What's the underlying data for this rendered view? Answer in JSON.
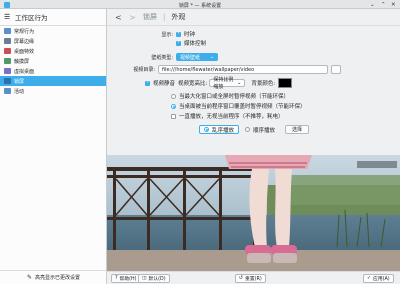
{
  "window": {
    "title": "锁屏 * — 系统设置",
    "min_glyph": "⌄",
    "max_glyph": "⌃",
    "close_glyph": "✕"
  },
  "sidebar": {
    "header": "工作区行为",
    "items": [
      {
        "label": "常规行为",
        "color": "#5a8fc9"
      },
      {
        "label": "屏幕边缘",
        "color": "#6a7f96"
      },
      {
        "label": "桌面特效",
        "color": "#c94f5a"
      },
      {
        "label": "触摸屏",
        "color": "#4f9a68"
      },
      {
        "label": "虚拟桌面",
        "color": "#7a6fc9"
      },
      {
        "label": "锁屏",
        "color": "#2e6fb0"
      },
      {
        "label": "活动",
        "color": "#5a8fc9"
      }
    ],
    "selected_index": 5,
    "footer": "高亮显示已更改设置"
  },
  "nav": {
    "back": "<",
    "forward": ">",
    "crumb": "锁屏",
    "separator": "|",
    "current": "外观"
  },
  "form": {
    "display_label": "显示:",
    "clock_label": "时钟",
    "media_label": "媒体控制",
    "wallpaper_type_label": "壁纸类型:",
    "wallpaper_type_value": "视频壁纸",
    "video_dir_label": "视频目录:",
    "video_dir_value": "file:///home/flewater/wallpaper/video",
    "mute_label": "视频静音",
    "ratio_label": "视频宽高比:",
    "ratio_value": "保持比例缩放",
    "bg_color_label": "背景颜色:",
    "bg_color": "#000000",
    "opt1": "当最大化窗口或全屏时暂停视频（节能环保）",
    "opt2": "当桌面被当前程序窗口覆盖时暂停视频（节能环保）",
    "opt3": "一直播放，无视当前程序（不推荐，耗电）",
    "order_seq": "乱序播放",
    "order_shuffle": "顺序播放",
    "browse_btn": "选择"
  },
  "bottom": {
    "help": "帮助(H)",
    "defaults": "默认(D)",
    "reset": "重置(R)",
    "apply": "应用(A)"
  },
  "colors": {
    "accent": "#3daee9"
  }
}
